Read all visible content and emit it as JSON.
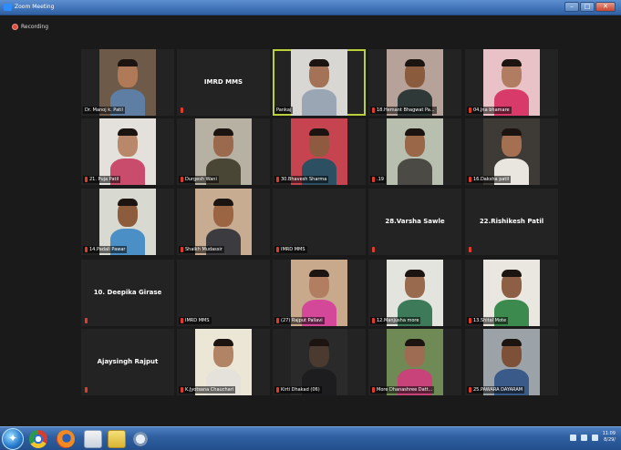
{
  "window": {
    "title": "Zoom Meeting"
  },
  "recording": {
    "label": "Recording"
  },
  "participants": [
    {
      "name": "Dr. Manoj k. Patil",
      "mic": false,
      "video": true,
      "skin": "#b07a58",
      "shirt": "#5e7fa3",
      "bg": "#6e5a48"
    },
    {
      "name": "IMRD MMS",
      "mic": true,
      "video": false
    },
    {
      "name": "Pankaj",
      "mic": false,
      "video": true,
      "active": true,
      "skin": "#a47256",
      "shirt": "#9aa6b4",
      "bg": "#d8d7d3"
    },
    {
      "name": "18.Hemant Bhagwat Pa...",
      "mic": true,
      "video": true,
      "skin": "#8b5b3e",
      "shirt": "#2f3a38",
      "bg": "#b7a29a"
    },
    {
      "name": "04.Jna bhamare",
      "mic": true,
      "video": true,
      "skin": "#b07c62",
      "shirt": "#d83a6a",
      "bg": "#e8c2c6"
    },
    {
      "name": "21. Puja Patil",
      "mic": true,
      "video": true,
      "skin": "#b9886a",
      "shirt": "#c94c6c",
      "bg": "#e4e1dd"
    },
    {
      "name": "Durgesh Wani",
      "mic": true,
      "video": true,
      "skin": "#9b6a4e",
      "shirt": "#4a4636",
      "bg": "#b6b1a2"
    },
    {
      "name": "30.Bhavesh Sharma",
      "mic": true,
      "video": true,
      "skin": "#8e5b40",
      "shirt": "#2d4f62",
      "bg": "#c64450"
    },
    {
      "name": ".19",
      "mic": true,
      "video": true,
      "skin": "#9a6748",
      "shirt": "#4b4a44",
      "bg": "#b9bfae"
    },
    {
      "name": "16.Daksha patil",
      "mic": true,
      "video": true,
      "skin": "#a57052",
      "shirt": "#e8e6df",
      "bg": "#3e3a35"
    },
    {
      "name": "14.Padali Pawar",
      "mic": true,
      "video": true,
      "skin": "#8d5c3c",
      "shirt": "#4a8fc6",
      "bg": "#d8d9d0"
    },
    {
      "name": "Shaikh Mudassir",
      "mic": true,
      "video": true,
      "skin": "#9b6544",
      "shirt": "#3c3c40",
      "bg": "#c8ac92"
    },
    {
      "name": "IMRD MMS",
      "mic": true,
      "video": false,
      "big": ""
    },
    {
      "name": "",
      "mic": true,
      "video": false,
      "big": "28.Varsha Sawle"
    },
    {
      "name": "",
      "mic": true,
      "video": false,
      "big": "22.Rishikesh Patil"
    },
    {
      "name": "",
      "mic": true,
      "video": false,
      "big": "10. Deepika Girase"
    },
    {
      "name": "IMRD MMS",
      "mic": true,
      "video": false,
      "big": ""
    },
    {
      "name": "(27) Rajput Pallavi",
      "mic": true,
      "video": true,
      "skin": "#b17e62",
      "shirt": "#d4489a",
      "bg": "#c9a98c"
    },
    {
      "name": "12.Manjusha more",
      "mic": true,
      "video": true,
      "skin": "#9a6a4e",
      "shirt": "#3d7a5a",
      "bg": "#e3e4de"
    },
    {
      "name": "13.Shital Mote",
      "mic": true,
      "video": true,
      "skin": "#8d5f45",
      "shirt": "#3c8a4d",
      "bg": "#e9e7df"
    },
    {
      "name": "",
      "mic": true,
      "video": false,
      "big": "Ajaysingh Rajput"
    },
    {
      "name": "K.Jyotsana Chauchari",
      "mic": true,
      "video": true,
      "skin": "#b28466",
      "shirt": "#e4e2db",
      "bg": "#ece6d6"
    },
    {
      "name": "Kirti Dhakad (06)",
      "mic": true,
      "video": true,
      "skin": "#4a3a30",
      "shirt": "#1d1d1f",
      "bg": "#2a2a2a"
    },
    {
      "name": "More Dhanashree Datt...",
      "mic": true,
      "video": true,
      "skin": "#9e6c52",
      "shirt": "#c8437a",
      "bg": "#6f8a55"
    },
    {
      "name": "25.PAWARA DAYARAM",
      "mic": true,
      "video": true,
      "skin": "#7d5038",
      "shirt": "#3a5a8a",
      "bg": "#9ca3a8"
    }
  ],
  "taskbar": {
    "apps": [
      "windows-start",
      "chrome",
      "firefox",
      "file-explorer",
      "sticky-notes",
      "zoom"
    ],
    "clock_time": "11:09",
    "clock_date": "8/29/"
  },
  "colors": {
    "active_speaker": "#b9d03b",
    "mic_muted": "#e23b2a",
    "background": "#1a1a1a"
  }
}
